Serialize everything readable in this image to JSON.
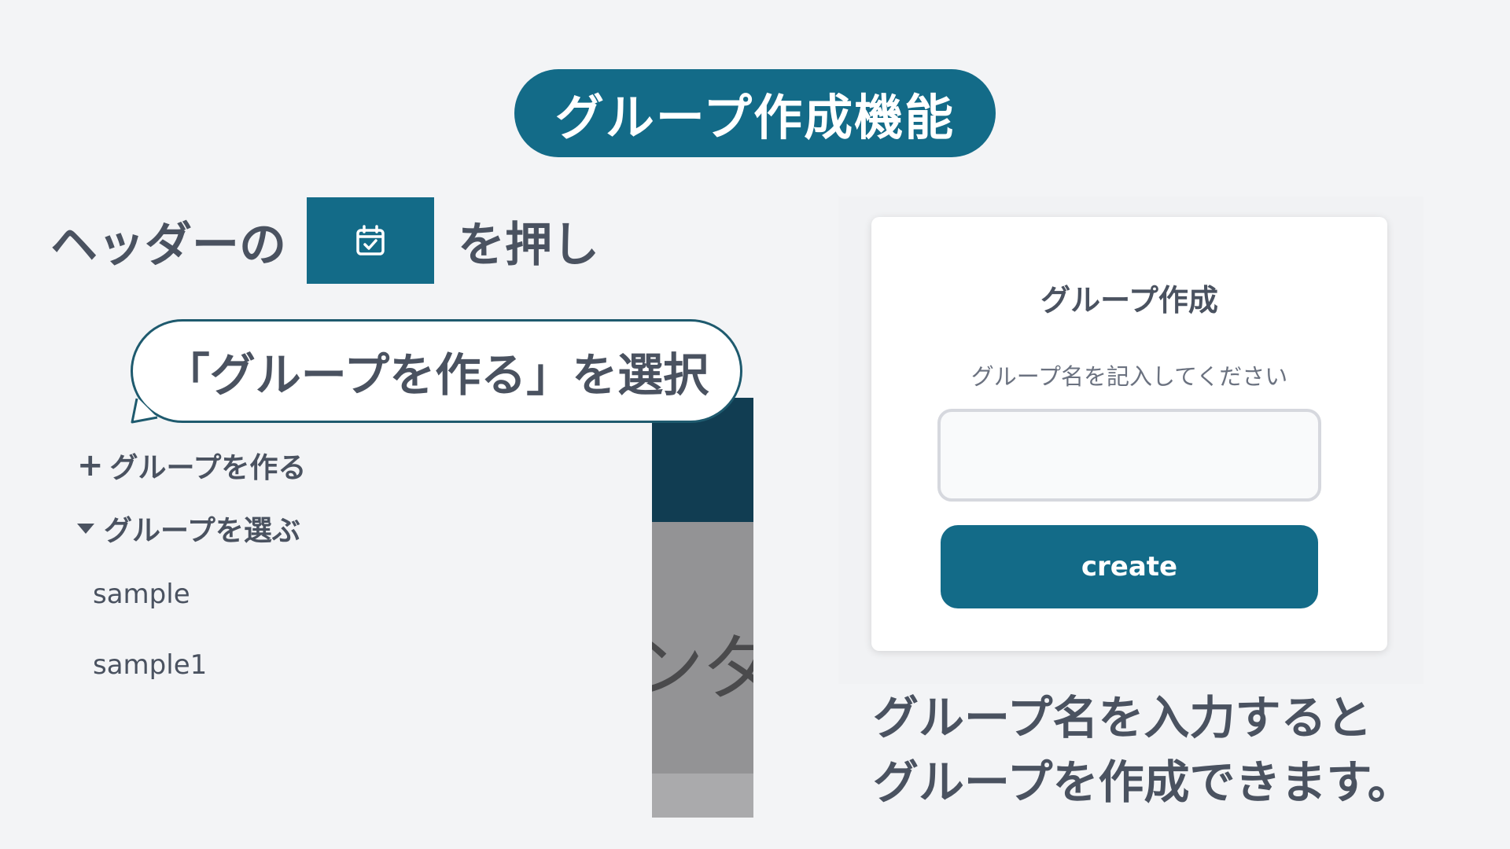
{
  "title": "グループ作成機能",
  "instruction": {
    "before_icon": "ヘッダーの",
    "icon": "calendar-check-icon",
    "after_icon": "を押し"
  },
  "bubble": {
    "text": "「グループを作る」を選択"
  },
  "sidebar": {
    "create_label": "グループを作る",
    "create_icon": "plus-icon",
    "select_label": "グループを選ぶ",
    "select_icon": "caret-down-icon",
    "groups": [
      "sample",
      "sample1"
    ],
    "partial_header_text": "ンダー"
  },
  "form": {
    "title": "グループ作成",
    "label": "グループ名を記入してください",
    "input_value": "",
    "input_placeholder": "",
    "button_label": "create"
  },
  "caption": {
    "line1": "グループ名を入力すると",
    "line2": "グループを作成できます。"
  },
  "colors": {
    "accent": "#136b88",
    "dark_header": "#113d52",
    "text": "#4a5260",
    "background": "#f3f4f6"
  }
}
